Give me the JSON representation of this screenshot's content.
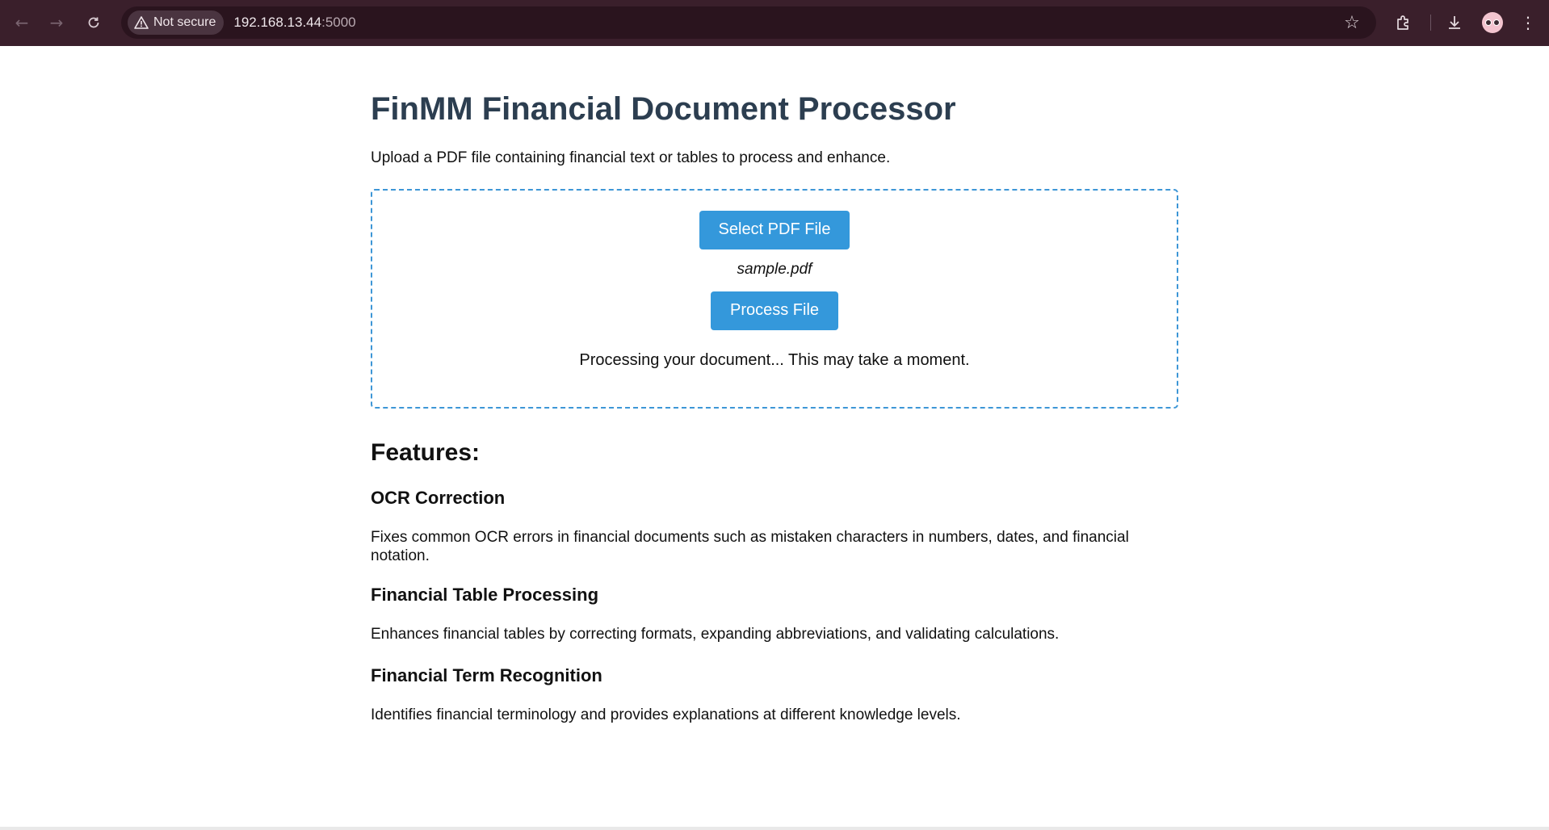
{
  "browser": {
    "security_label": "Not secure",
    "url_host": "192.168.13.44",
    "url_port": ":5000"
  },
  "page": {
    "title": "FinMM Financial Document Processor",
    "intro": "Upload a PDF file containing financial text or tables to process and enhance.",
    "upload": {
      "select_button": "Select PDF File",
      "file_name": "sample.pdf",
      "process_button": "Process File",
      "status": "Processing your document... This may take a moment."
    },
    "features_heading": "Features:",
    "features": [
      {
        "title": "OCR Correction",
        "description": "Fixes common OCR errors in financial documents such as mistaken characters in numbers, dates, and financial notation."
      },
      {
        "title": "Financial Table Processing",
        "description": "Enhances financial tables by correcting formats, expanding abbreviations, and validating calculations."
      },
      {
        "title": "Financial Term Recognition",
        "description": "Identifies financial terminology and provides explanations at different knowledge levels."
      }
    ]
  },
  "colors": {
    "chrome_bg": "#3a1f2b",
    "title": "#2c3e50",
    "accent": "#3498db"
  }
}
